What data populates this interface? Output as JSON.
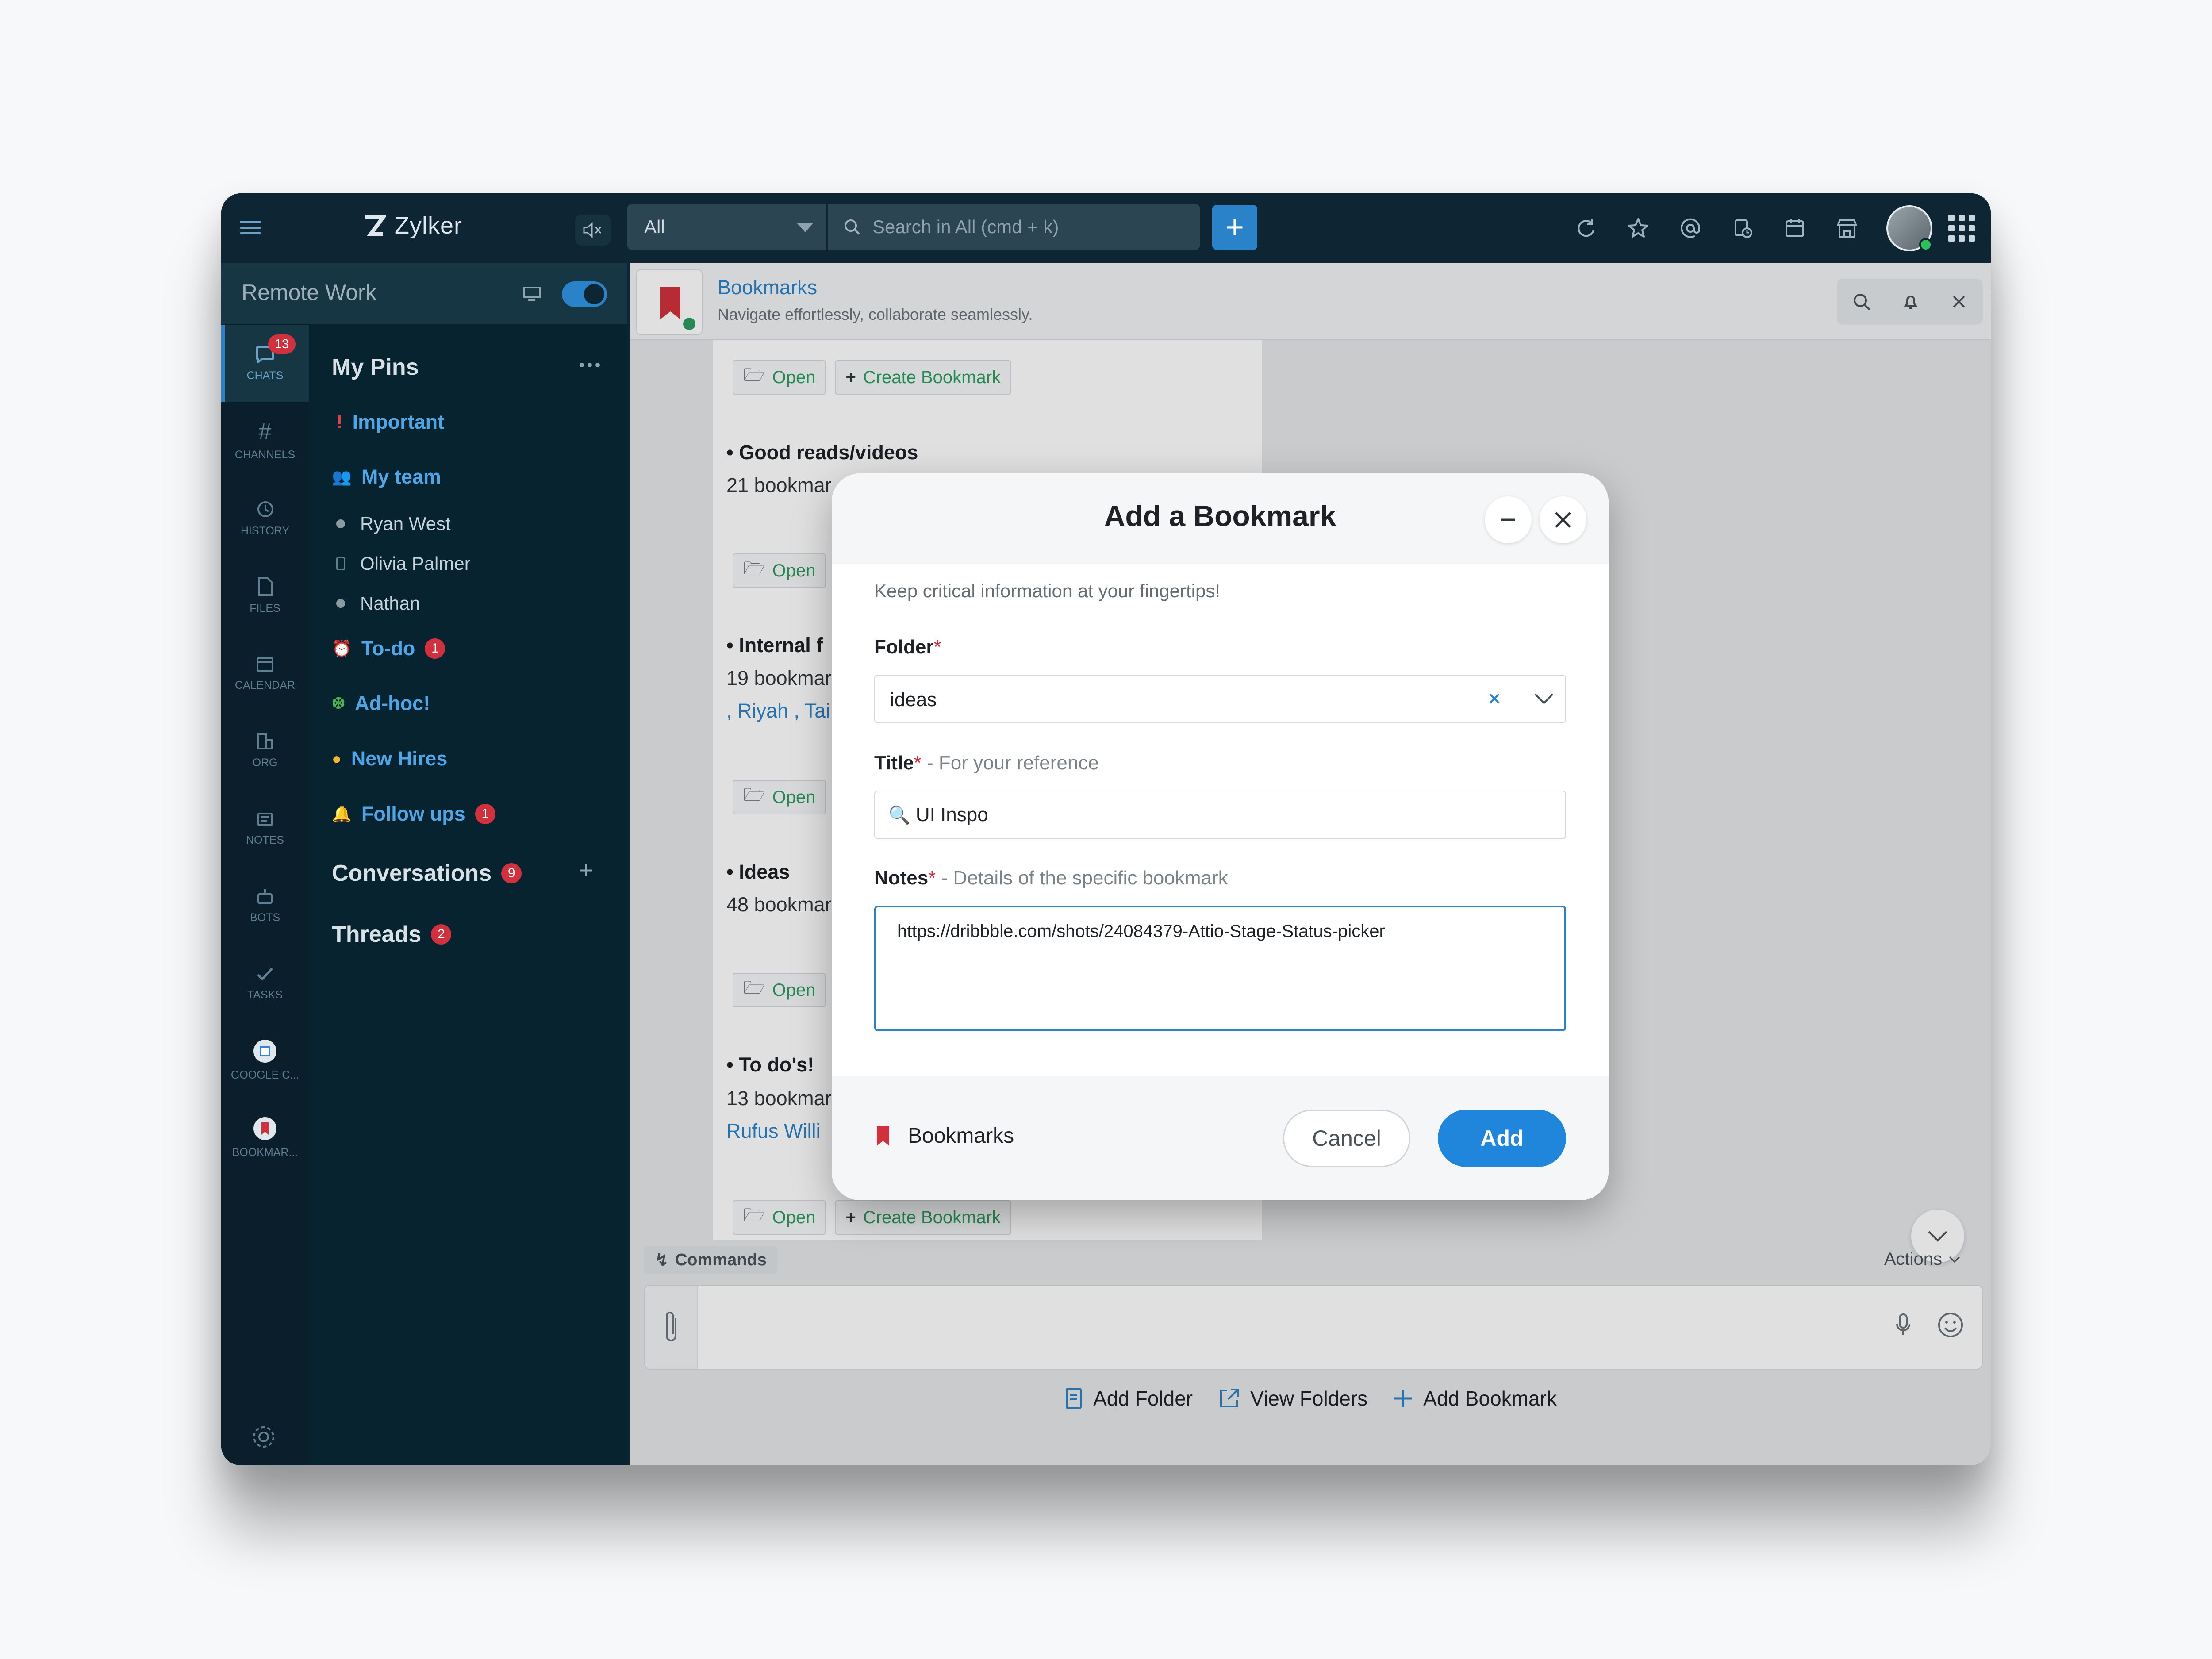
{
  "app": {
    "brand": "Zylker",
    "org_name": "Remote Work",
    "search_scope": "All",
    "search_placeholder": "Search in All (cmd + k)",
    "add_label": "+"
  },
  "rail": {
    "items": [
      {
        "label": "CHATS",
        "icon": "chat-icon",
        "badge": "13"
      },
      {
        "label": "CHANNELS",
        "icon": "hash-icon"
      },
      {
        "label": "HISTORY",
        "icon": "history-icon"
      },
      {
        "label": "FILES",
        "icon": "file-icon"
      },
      {
        "label": "CALENDAR",
        "icon": "calendar-icon"
      },
      {
        "label": "ORG",
        "icon": "org-icon"
      },
      {
        "label": "NOTES",
        "icon": "notes-icon"
      },
      {
        "label": "BOTS",
        "icon": "bot-icon"
      },
      {
        "label": "TASKS",
        "icon": "tasks-icon"
      },
      {
        "label": "GOOGLE C...",
        "icon": "google-calendar-icon"
      },
      {
        "label": "BOOKMAR...",
        "icon": "bookmark-icon"
      }
    ]
  },
  "sidebar": {
    "pins_title": "My Pins",
    "important": "Important",
    "my_team": "My team",
    "members": [
      "Ryan West",
      "Olivia Palmer",
      "Nathan"
    ],
    "todo": "To-do",
    "todo_badge": "1",
    "adhoc": "Ad-hoc!",
    "new_hires": "New Hires",
    "follow_ups": "Follow ups",
    "follow_ups_badge": "1",
    "conversations": "Conversations",
    "conversations_badge": "9",
    "threads": "Threads",
    "threads_badge": "2"
  },
  "bot": {
    "title": "Bookmarks",
    "subtitle": "Navigate effortlessly, collaborate seamlessly."
  },
  "chat": {
    "open_label": "Open",
    "create_label": "Create Bookmark",
    "sections": [
      {
        "title": "• Good reads/videos",
        "meta": "21 bookmar"
      },
      {
        "title": "• Internal f",
        "meta": "19 bookmar",
        "links": ", Riyah , Tai"
      },
      {
        "title": "• Ideas",
        "meta": "48 bookmar"
      },
      {
        "title": "• To do's!",
        "meta": "13 bookmar",
        "links": "Rufus Willi"
      }
    ]
  },
  "composer": {
    "commands": "Commands",
    "actions": "Actions",
    "add_folder": "Add Folder",
    "view_folders": "View Folders",
    "add_bookmark": "Add Bookmark"
  },
  "modal": {
    "title": "Add a Bookmark",
    "hint": "Keep critical information at your fingertips!",
    "folder_label": "Folder",
    "folder_value": "ideas",
    "title_label": "Title",
    "title_note": "- For your reference",
    "title_value": "UI Inspo",
    "notes_label": "Notes",
    "notes_note": "- Details of the specific bookmark",
    "notes_value": "https://dribbble.com/shots/24084379-Attio-Stage-Status-picker",
    "required_mark": "*",
    "footer_brand": "Bookmarks",
    "cancel_label": "Cancel",
    "add_label": "Add"
  },
  "colors": {
    "accent": "#2a82c9",
    "badge": "#d0313c",
    "sidebar_bg": "#082330",
    "open_green": "#2c9b5f"
  }
}
